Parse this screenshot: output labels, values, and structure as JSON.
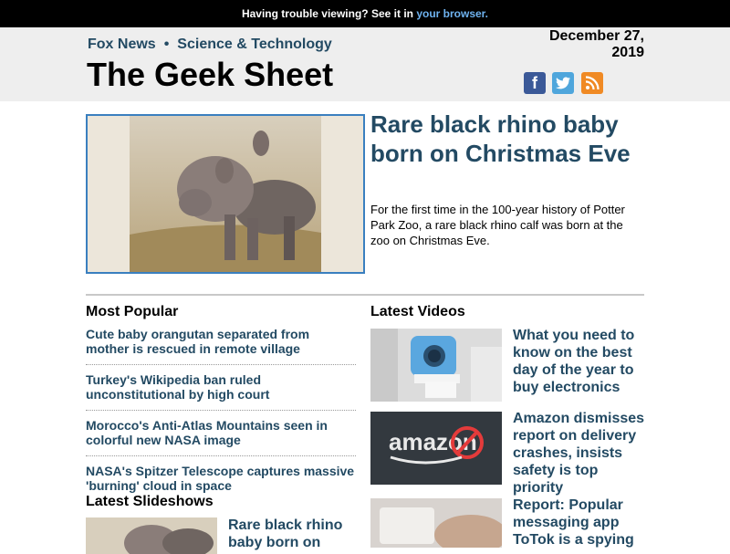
{
  "topbar": {
    "text": "Having trouble viewing? See it in ",
    "link": "your browser."
  },
  "header": {
    "breadcrumb": [
      "Fox News",
      "Science & Technology"
    ],
    "separator": "•",
    "title": "The Geek Sheet",
    "date": "December 27, 2019",
    "social": [
      {
        "name": "facebook-icon",
        "glyph": "f",
        "color": "#3b5998"
      },
      {
        "name": "twitter-icon",
        "glyph": "",
        "color": "#4fa6dc"
      },
      {
        "name": "rss-icon",
        "glyph": "",
        "color": "#f08a24"
      }
    ]
  },
  "hero": {
    "title": "Rare black rhino baby born on Christmas Eve",
    "description": "For the first time in the 100-year history of Potter Park Zoo, a rare black rhino calf was born at the zoo on Christmas Eve."
  },
  "most_popular": {
    "heading": "Most Popular",
    "items": [
      "Cute baby orangutan separated from mother is rescued in remote village",
      "Turkey's Wikipedia ban ruled unconstitutional by high court",
      "Morocco's Anti-Atlas Mountains seen in colorful new NASA image",
      "NASA's Spitzer Telescope captures massive 'burning' cloud in space"
    ]
  },
  "latest_videos": {
    "heading": "Latest Videos",
    "items": [
      "What you need to know on the best day of the year to buy electronics",
      "Amazon dismisses report on delivery crashes, insists safety is top priority",
      "Report: Popular messaging app ToTok is a spying"
    ],
    "thumb_text": "amazon"
  },
  "latest_slideshows": {
    "heading": "Latest Slideshows",
    "items": [
      "Rare black rhino baby born on"
    ]
  }
}
